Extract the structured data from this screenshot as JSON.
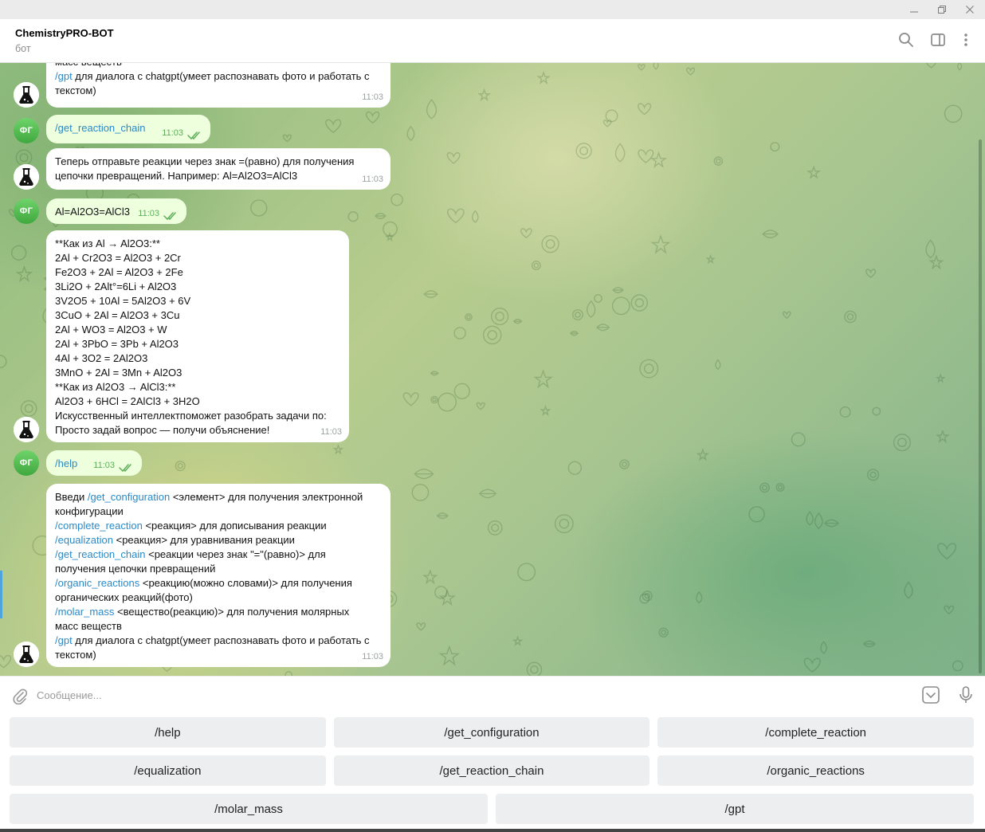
{
  "window": {
    "minimize_icon": "minimize-icon",
    "restore_icon": "restore-icon",
    "close_icon": "close-icon"
  },
  "header": {
    "title": "ChemistryPRO-BOT",
    "subtitle": "бот"
  },
  "colors": {
    "command_link": "#2a8ac7",
    "outgoing_bubble": "#eeffde",
    "read_check": "#5fae5a",
    "user_avatar": "#4fbf4c"
  },
  "user_avatar_initials": "ФГ",
  "messages": [
    {
      "from": "bot",
      "lines": [
        [
          {
            "t": "масс веществ"
          }
        ],
        [
          {
            "t": "/gpt",
            "c": 1
          },
          {
            "t": " для диалога с chatgpt(умеет распознавать фото и работать с"
          }
        ],
        [
          {
            "t": "текстом)"
          }
        ]
      ],
      "time": "11:03"
    },
    {
      "from": "user",
      "lines": [
        [
          {
            "t": "/get_reaction_chain",
            "c": 1
          }
        ]
      ],
      "time": "11:03"
    },
    {
      "from": "bot",
      "lines": [
        [
          {
            "t": "Теперь отправьте реакции через знак =(равно) для получения"
          }
        ],
        [
          {
            "t": "цепочки превращений. Например: Al=Al2O3=AlCl3"
          }
        ]
      ],
      "time": "11:03"
    },
    {
      "from": "user",
      "lines": [
        [
          {
            "t": "Al=Al2O3=AlCl3"
          }
        ]
      ],
      "time": "11:03"
    },
    {
      "from": "bot",
      "lines": [
        [
          {
            "t": "**Как из Al → Al2O3:**"
          }
        ],
        [
          {
            "t": "2Al + Cr2O3 = Al2O3 + 2Cr"
          }
        ],
        [
          {
            "t": "Fe2O3 + 2Al = Al2O3 + 2Fe"
          }
        ],
        [
          {
            "t": "3Li2O + 2Alt°=6Li + Al2O3"
          }
        ],
        [
          {
            "t": "3V2O5 + 10Al = 5Al2O3 + 6V"
          }
        ],
        [
          {
            "t": "3CuO + 2Al = Al2O3 + 3Cu"
          }
        ],
        [
          {
            "t": "2Al + WO3 = Al2O3 + W"
          }
        ],
        [
          {
            "t": "2Al + 3PbO = 3Pb + Al2O3"
          }
        ],
        [
          {
            "t": "4Al + 3O2 = 2Al2O3"
          }
        ],
        [
          {
            "t": "3MnO + 2Al = 3Mn + Al2O3"
          }
        ],
        [
          {
            "t": "**Как из Al2O3 → AlCl3:**"
          }
        ],
        [
          {
            "t": "Al2O3 + 6HCl = 2AlCl3 + 3H2O"
          }
        ],
        [
          {
            "t": "Искусственный интеллектпоможет разобрать задачи по:"
          }
        ],
        [
          {
            "t": "Просто задай вопрос — получи объяснение!"
          }
        ]
      ],
      "time": "11:03"
    },
    {
      "from": "user",
      "lines": [
        [
          {
            "t": "/help",
            "c": 1
          }
        ]
      ],
      "time": "11:03"
    },
    {
      "from": "bot",
      "lines": [
        [
          {
            "t": "Введи "
          },
          {
            "t": "/get_configuration",
            "c": 1
          },
          {
            "t": " <элемент> для получения электронной"
          }
        ],
        [
          {
            "t": "конфигурации"
          }
        ],
        [
          {
            "t": "/complete_reaction",
            "c": 1
          },
          {
            "t": " <реакция> для дописывания реакции"
          }
        ],
        [
          {
            "t": "/equalization",
            "c": 1
          },
          {
            "t": " <реакция> для уравнивания реакции"
          }
        ],
        [
          {
            "t": "/get_reaction_chain",
            "c": 1
          },
          {
            "t": " <реакции через знак \"=\"(равно)> для"
          }
        ],
        [
          {
            "t": "получения цепочки превращений"
          }
        ],
        [
          {
            "t": "/organic_reactions",
            "c": 1
          },
          {
            "t": " <реакцию(можно словами)> для получения"
          }
        ],
        [
          {
            "t": "органических реакций(фото)"
          }
        ],
        [
          {
            "t": "/molar_mass",
            "c": 1
          },
          {
            "t": " <вещество(реакцию)> для получения молярных"
          }
        ],
        [
          {
            "t": "масс веществ"
          }
        ],
        [
          {
            "t": "/gpt",
            "c": 1
          },
          {
            "t": " для диалога с chatgpt(умеет распознавать фото и работать с"
          }
        ],
        [
          {
            "t": "текстом)"
          }
        ]
      ],
      "time": "11:03"
    }
  ],
  "input": {
    "placeholder": "Сообщение...",
    "value": ""
  },
  "keyboard": [
    [
      "/help",
      "/get_configuration",
      "/complete_reaction"
    ],
    [
      "/equalization",
      "/get_reaction_chain",
      "/organic_reactions"
    ],
    [
      "/molar_mass",
      "/gpt"
    ]
  ]
}
